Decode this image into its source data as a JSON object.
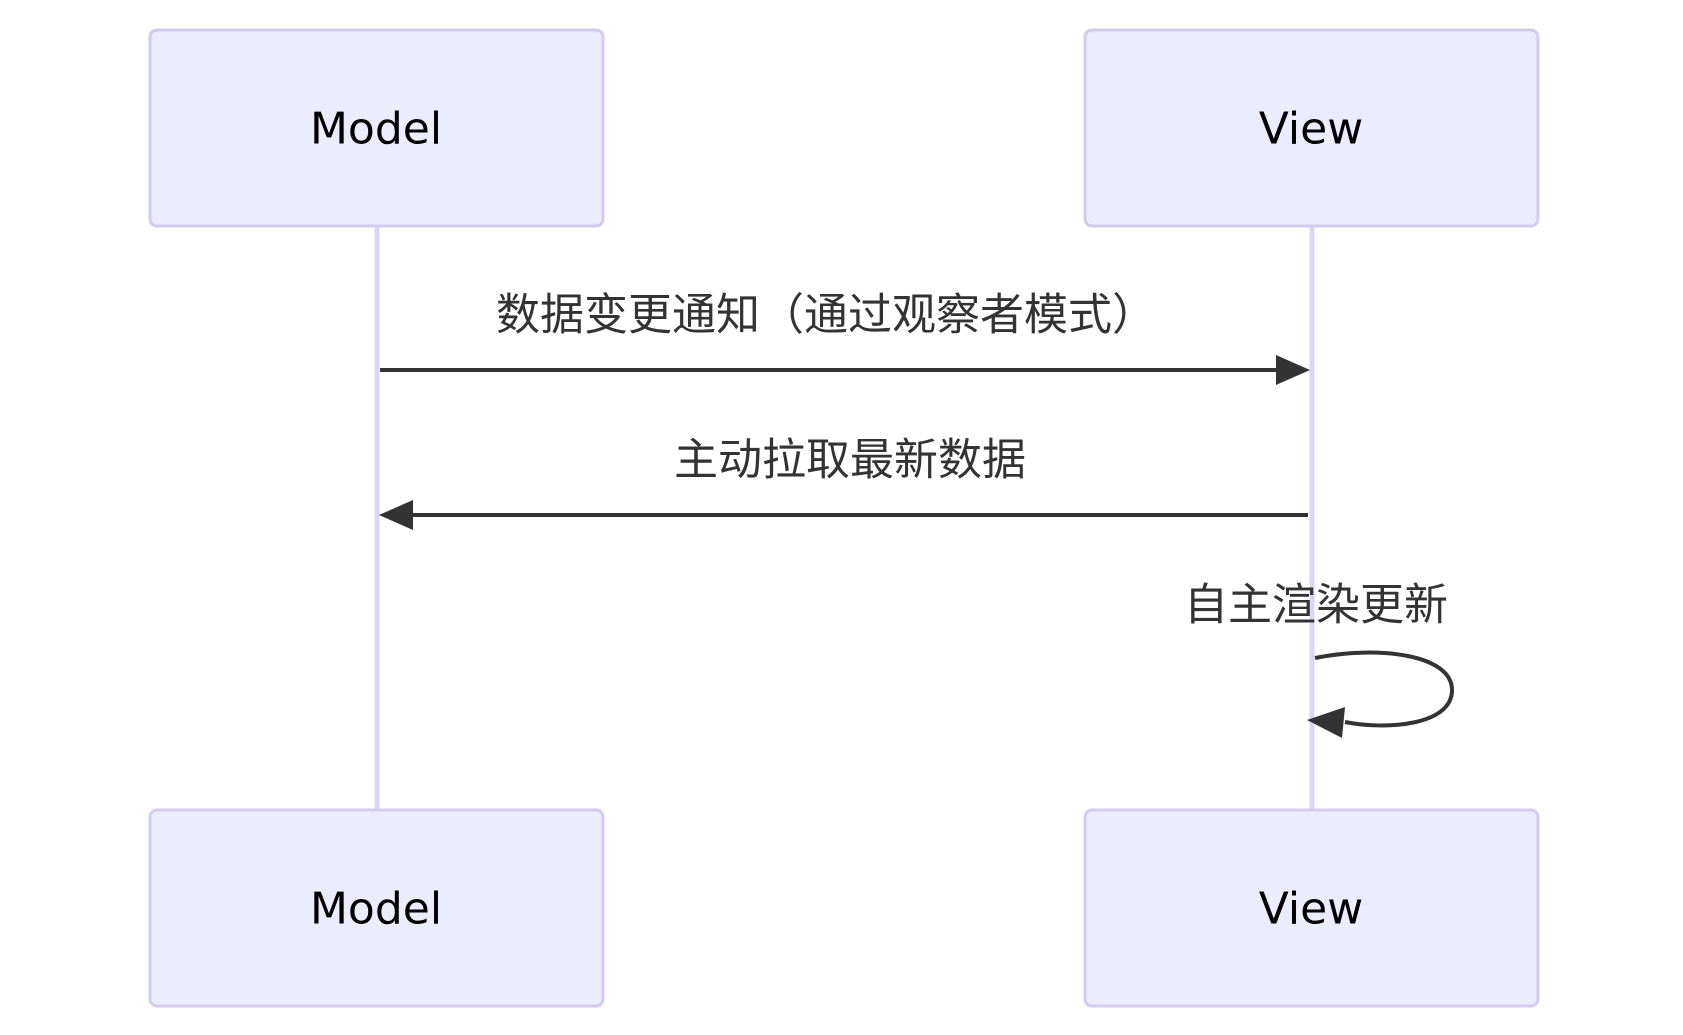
{
  "participants": {
    "model": {
      "label": "Model"
    },
    "view": {
      "label": "View"
    }
  },
  "messages": [
    {
      "from": "Model",
      "to": "View",
      "label": "数据变更通知（通过观察者模式）"
    },
    {
      "from": "View",
      "to": "Model",
      "label": "主动拉取最新数据"
    },
    {
      "from": "View",
      "to": "View",
      "label": "自主渲染更新"
    }
  ],
  "colors": {
    "actor_fill": "#ececff",
    "actor_border": "#d3cbef",
    "lifeline": "#dcd6f4",
    "message": "#333333"
  }
}
